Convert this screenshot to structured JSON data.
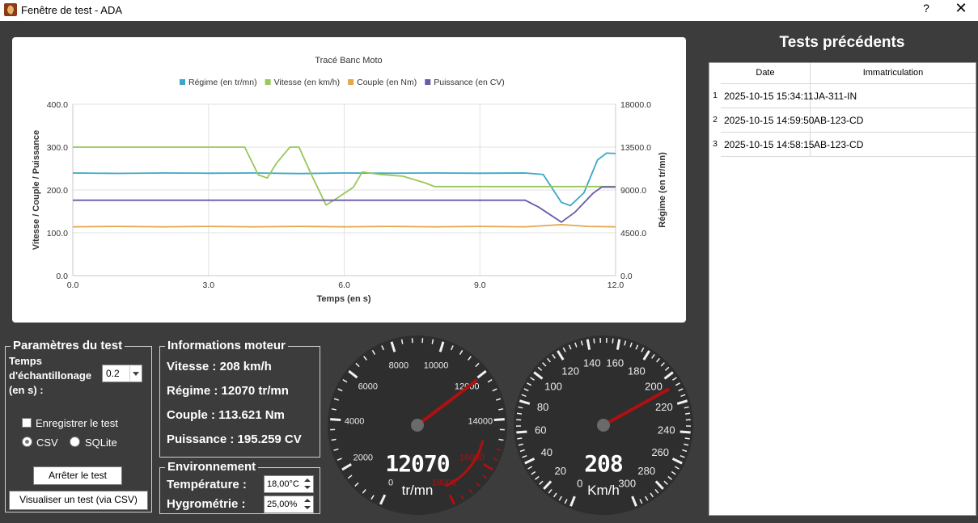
{
  "window": {
    "title": "Fenêtre de test - ADA",
    "help_label": "?",
    "close_label": "✕"
  },
  "chart_data": {
    "type": "line",
    "title": "Tracé Banc Moto",
    "xlabel": "Temps (en s)",
    "ylabel_left": "Vitesse / Couple / Puissance",
    "ylabel_right": "Régime (en tr/mn)",
    "xlim": [
      0,
      12
    ],
    "ylim_left": [
      0,
      400
    ],
    "ylim_right": [
      0,
      18000
    ],
    "x_ticks": [
      "0.0",
      "3.0",
      "6.0",
      "9.0",
      "12.0"
    ],
    "y_ticks_left": [
      "0.0",
      "100.0",
      "200.0",
      "300.0",
      "400.0"
    ],
    "y_ticks_right": [
      "0.0",
      "4500.0",
      "9000.0",
      "13500.0",
      "18000.0"
    ],
    "grid": true,
    "legend_position": "top",
    "series": [
      {
        "name": "Régime (en tr/mn)",
        "axis": "right",
        "color": "#3aa7c8",
        "points": [
          [
            0,
            10780
          ],
          [
            1,
            10740
          ],
          [
            2,
            10780
          ],
          [
            3,
            10760
          ],
          [
            4,
            10780
          ],
          [
            5,
            10720
          ],
          [
            6,
            10780
          ],
          [
            7,
            10760
          ],
          [
            8,
            10780
          ],
          [
            9,
            10760
          ],
          [
            10,
            10780
          ],
          [
            10.4,
            10620
          ],
          [
            10.8,
            7700
          ],
          [
            11,
            7350
          ],
          [
            11.3,
            8700
          ],
          [
            11.6,
            12150
          ],
          [
            11.8,
            12870
          ],
          [
            12,
            12830
          ]
        ]
      },
      {
        "name": "Vitesse (en km/h)",
        "axis": "left",
        "color": "#98c75a",
        "points": [
          [
            0,
            300
          ],
          [
            3.8,
            300
          ],
          [
            4.1,
            235
          ],
          [
            4.3,
            228
          ],
          [
            4.5,
            262
          ],
          [
            4.8,
            300
          ],
          [
            5,
            300
          ],
          [
            5.3,
            230
          ],
          [
            5.6,
            165
          ],
          [
            5.8,
            178
          ],
          [
            6.2,
            206
          ],
          [
            6.4,
            242
          ],
          [
            6.8,
            236
          ],
          [
            7.3,
            232
          ],
          [
            7.8,
            216
          ],
          [
            8,
            208
          ],
          [
            9,
            208
          ],
          [
            10,
            208
          ],
          [
            11,
            208
          ],
          [
            12,
            208
          ]
        ]
      },
      {
        "name": "Couple (en Nm)",
        "axis": "left",
        "color": "#e3a64a",
        "points": [
          [
            0,
            114
          ],
          [
            1,
            115
          ],
          [
            2,
            114
          ],
          [
            3,
            115
          ],
          [
            4,
            114
          ],
          [
            5,
            115
          ],
          [
            6,
            114
          ],
          [
            7,
            115
          ],
          [
            8,
            114
          ],
          [
            9,
            115
          ],
          [
            10,
            114
          ],
          [
            10.8,
            119
          ],
          [
            11.4,
            115
          ],
          [
            12,
            114
          ]
        ]
      },
      {
        "name": "Puissance (en CV)",
        "axis": "left",
        "color": "#6a5aa8",
        "points": [
          [
            0,
            176
          ],
          [
            1,
            176
          ],
          [
            2,
            176
          ],
          [
            3,
            176
          ],
          [
            4,
            176
          ],
          [
            5,
            176
          ],
          [
            6,
            176
          ],
          [
            7,
            176
          ],
          [
            8,
            176
          ],
          [
            9,
            176
          ],
          [
            10,
            176
          ],
          [
            10.3,
            160
          ],
          [
            10.8,
            125
          ],
          [
            11.1,
            148
          ],
          [
            11.5,
            192
          ],
          [
            11.7,
            207
          ],
          [
            12,
            207
          ]
        ]
      }
    ]
  },
  "tests": {
    "title": "Tests précédents",
    "columns": [
      "Date",
      "Immatriculation"
    ],
    "rows": [
      {
        "num": "1",
        "date": "2025-10-15 15:34:11",
        "immat": "JA-311-IN"
      },
      {
        "num": "2",
        "date": "2025-10-15 14:59:50",
        "immat": "AB-123-CD"
      },
      {
        "num": "3",
        "date": "2025-10-15 14:58:15",
        "immat": "AB-123-CD"
      }
    ]
  },
  "params": {
    "title": "Paramètres du test",
    "sampling_label_1": "Temps",
    "sampling_label_2": "d'échantillonage",
    "sampling_label_3": "(en s) :",
    "sampling_value": "0.2",
    "save_label": "Enregistrer le test",
    "csv_label": "CSV",
    "sqlite_label": "SQLite",
    "stop_button": "Arrêter le test",
    "view_button": "Visualiser un test (via CSV)"
  },
  "engine": {
    "title": "Informations moteur",
    "speed": "Vitesse : 208 km/h",
    "rpm": "Régime : 12070 tr/mn",
    "torque": "Couple : 113.621 Nm",
    "power": "Puissance : 195.259 CV"
  },
  "environment": {
    "title": "Environnement",
    "temp_label": "Température :",
    "temp_value": "18,00°C",
    "hygro_label": "Hygrométrie :",
    "hygro_value": "25,00%"
  },
  "gauge_rpm": {
    "value": 12070,
    "display": "12070",
    "unit": "tr/mn",
    "labels": [
      "0",
      "2000",
      "4000",
      "6000",
      "8000",
      "10000",
      "12000",
      "14000",
      "16000",
      "18000"
    ],
    "red_color": "#b01010",
    "needle_color": "#b01010"
  },
  "gauge_speed": {
    "value": 208,
    "display": "208",
    "unit": "Km/h",
    "labels": [
      "0",
      "20",
      "40",
      "60",
      "80",
      "100",
      "120",
      "140",
      "160",
      "180",
      "200",
      "220",
      "240",
      "260",
      "280",
      "300"
    ],
    "needle_color": "#b01010"
  }
}
